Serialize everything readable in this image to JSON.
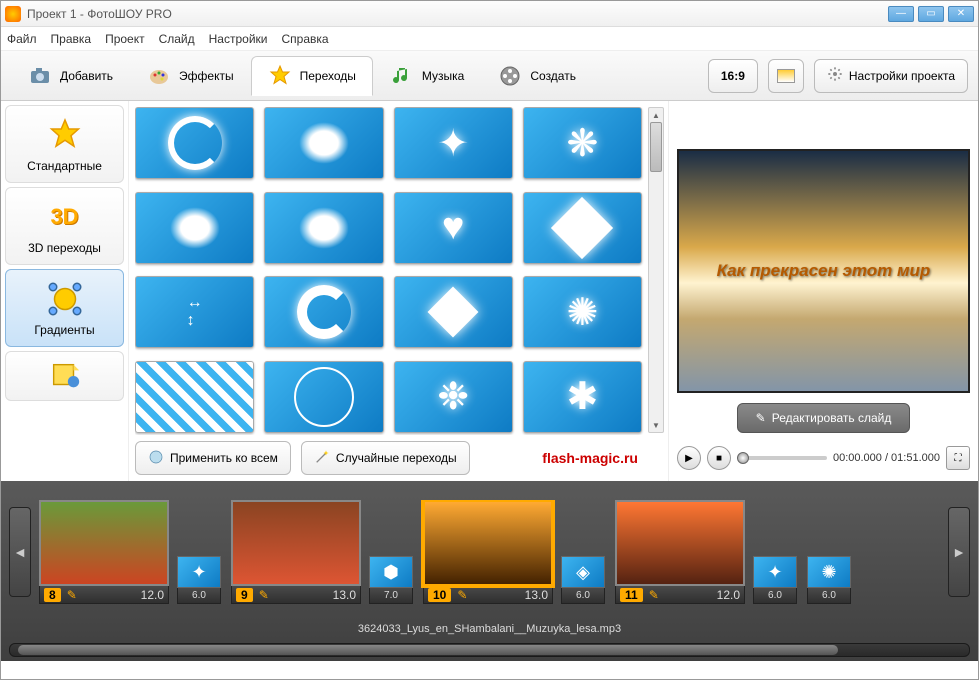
{
  "window": {
    "title": "Проект 1 - ФотоШОУ PRO"
  },
  "menu": [
    "Файл",
    "Правка",
    "Проект",
    "Слайд",
    "Настройки",
    "Справка"
  ],
  "tabs": {
    "add": "Добавить",
    "effects": "Эффекты",
    "transitions": "Переходы",
    "music": "Музыка",
    "create": "Создать"
  },
  "toolbar": {
    "aspect": "16:9",
    "project_settings": "Настройки проекта"
  },
  "categories": {
    "standard": "Стандартные",
    "three_d": "3D переходы",
    "gradients": "Градиенты"
  },
  "three_d_label": "3D",
  "grid_buttons": {
    "apply_all": "Применить ко всем",
    "random": "Случайные переходы"
  },
  "watermark": "flash-magic.ru",
  "preview": {
    "caption": "Как  прекрасен этот мир",
    "edit": "Редактировать слайд",
    "time": "00:00.000 / 01:51.000"
  },
  "timeline": {
    "slides": [
      {
        "num": "8",
        "dur": "12.0",
        "trans_dur": "6.0"
      },
      {
        "num": "9",
        "dur": "13.0",
        "trans_dur": "7.0"
      },
      {
        "num": "10",
        "dur": "13.0",
        "trans_dur": "6.0"
      },
      {
        "num": "11",
        "dur": "12.0",
        "trans_dur": "6.0"
      }
    ],
    "extra_trans_dur": "6.0",
    "audio": "3624033_Lyus_en_SHambalani__Muzuyka_lesa.mp3"
  }
}
